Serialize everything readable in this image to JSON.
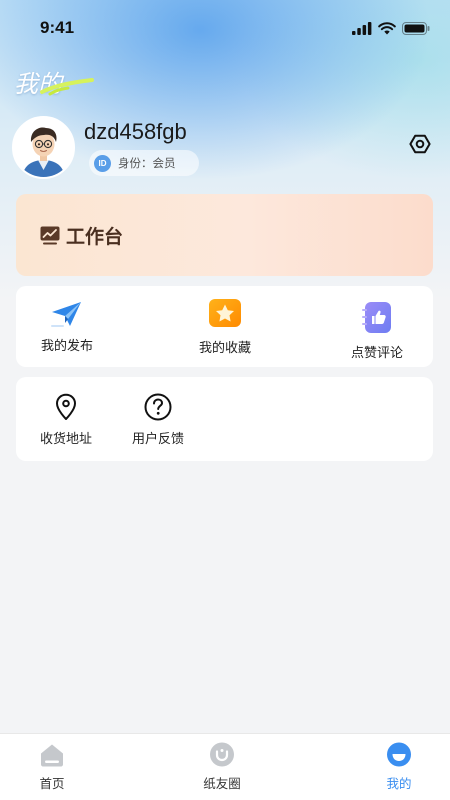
{
  "status_bar": {
    "time": "9:41",
    "icons": [
      "signal-icon",
      "wifi-icon",
      "battery-icon"
    ]
  },
  "page": {
    "title": "我的"
  },
  "profile": {
    "username": "dzd458fgb",
    "id_badge": "ID",
    "role_text": "身份：会员",
    "settings_icon": "settings-icon"
  },
  "workbench": {
    "label": "工作台",
    "icon": "chart-trend-icon"
  },
  "quick_actions": [
    {
      "label": "我的发布",
      "icon": "paper-plane-icon"
    },
    {
      "label": "我的收藏",
      "icon": "star-icon"
    },
    {
      "label": "点赞评论",
      "icon": "thumbs-up-icon"
    }
  ],
  "services": [
    {
      "label": "收货地址",
      "icon": "location-pin-icon"
    },
    {
      "label": "用户反馈",
      "icon": "question-icon"
    }
  ],
  "tab_bar": {
    "items": [
      {
        "label": "首页",
        "icon": "home-icon"
      },
      {
        "label": "纸友圈",
        "icon": "circle-chat-icon"
      },
      {
        "label": "我的",
        "icon": "profile-icon"
      }
    ],
    "active_index": 2,
    "active_color": "#3a8ef0",
    "inactive_color": "#c5c8cc"
  }
}
